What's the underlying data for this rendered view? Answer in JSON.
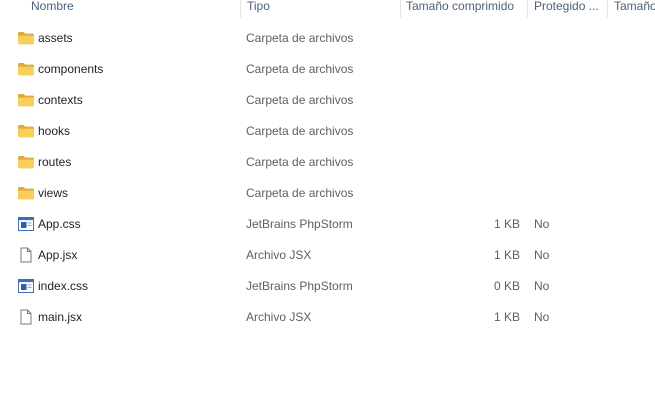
{
  "columns": {
    "name": "Nombre",
    "type": "Tipo",
    "compressed_size": "Tamaño comprimido",
    "protected": "Protegido ...",
    "size": "Tamaño"
  },
  "rows": [
    {
      "name": "assets",
      "type": "Carpeta de archivos",
      "size": "",
      "protected": "",
      "icon": "folder-icon"
    },
    {
      "name": "components",
      "type": "Carpeta de archivos",
      "size": "",
      "protected": "",
      "icon": "folder-icon"
    },
    {
      "name": "contexts",
      "type": "Carpeta de archivos",
      "size": "",
      "protected": "",
      "icon": "folder-icon"
    },
    {
      "name": "hooks",
      "type": "Carpeta de archivos",
      "size": "",
      "protected": "",
      "icon": "folder-icon"
    },
    {
      "name": "routes",
      "type": "Carpeta de archivos",
      "size": "",
      "protected": "",
      "icon": "folder-icon"
    },
    {
      "name": "views",
      "type": "Carpeta de archivos",
      "size": "",
      "protected": "",
      "icon": "folder-icon"
    },
    {
      "name": "App.css",
      "type": "JetBrains PhpStorm",
      "size": "1 KB",
      "protected": "No",
      "icon": "css-file-icon"
    },
    {
      "name": "App.jsx",
      "type": "Archivo JSX",
      "size": "1 KB",
      "protected": "No",
      "icon": "generic-file-icon"
    },
    {
      "name": "index.css",
      "type": "JetBrains PhpStorm",
      "size": "0 KB",
      "protected": "No",
      "icon": "css-file-icon"
    },
    {
      "name": "main.jsx",
      "type": "Archivo JSX",
      "size": "1 KB",
      "protected": "No",
      "icon": "generic-file-icon"
    }
  ]
}
